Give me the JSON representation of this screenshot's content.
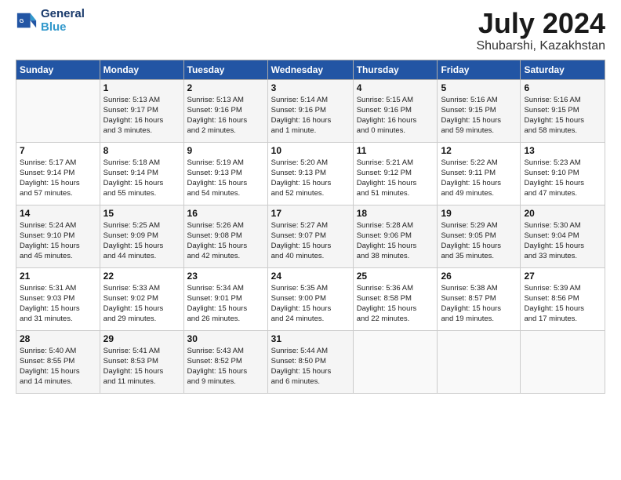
{
  "logo": {
    "line1": "General",
    "line2": "Blue"
  },
  "title": "July 2024",
  "location": "Shubarshi, Kazakhstan",
  "days_header": [
    "Sunday",
    "Monday",
    "Tuesday",
    "Wednesday",
    "Thursday",
    "Friday",
    "Saturday"
  ],
  "weeks": [
    [
      {
        "num": "",
        "info": ""
      },
      {
        "num": "1",
        "info": "Sunrise: 5:13 AM\nSunset: 9:17 PM\nDaylight: 16 hours\nand 3 minutes."
      },
      {
        "num": "2",
        "info": "Sunrise: 5:13 AM\nSunset: 9:16 PM\nDaylight: 16 hours\nand 2 minutes."
      },
      {
        "num": "3",
        "info": "Sunrise: 5:14 AM\nSunset: 9:16 PM\nDaylight: 16 hours\nand 1 minute."
      },
      {
        "num": "4",
        "info": "Sunrise: 5:15 AM\nSunset: 9:16 PM\nDaylight: 16 hours\nand 0 minutes."
      },
      {
        "num": "5",
        "info": "Sunrise: 5:16 AM\nSunset: 9:15 PM\nDaylight: 15 hours\nand 59 minutes."
      },
      {
        "num": "6",
        "info": "Sunrise: 5:16 AM\nSunset: 9:15 PM\nDaylight: 15 hours\nand 58 minutes."
      }
    ],
    [
      {
        "num": "7",
        "info": "Sunrise: 5:17 AM\nSunset: 9:14 PM\nDaylight: 15 hours\nand 57 minutes."
      },
      {
        "num": "8",
        "info": "Sunrise: 5:18 AM\nSunset: 9:14 PM\nDaylight: 15 hours\nand 55 minutes."
      },
      {
        "num": "9",
        "info": "Sunrise: 5:19 AM\nSunset: 9:13 PM\nDaylight: 15 hours\nand 54 minutes."
      },
      {
        "num": "10",
        "info": "Sunrise: 5:20 AM\nSunset: 9:13 PM\nDaylight: 15 hours\nand 52 minutes."
      },
      {
        "num": "11",
        "info": "Sunrise: 5:21 AM\nSunset: 9:12 PM\nDaylight: 15 hours\nand 51 minutes."
      },
      {
        "num": "12",
        "info": "Sunrise: 5:22 AM\nSunset: 9:11 PM\nDaylight: 15 hours\nand 49 minutes."
      },
      {
        "num": "13",
        "info": "Sunrise: 5:23 AM\nSunset: 9:10 PM\nDaylight: 15 hours\nand 47 minutes."
      }
    ],
    [
      {
        "num": "14",
        "info": "Sunrise: 5:24 AM\nSunset: 9:10 PM\nDaylight: 15 hours\nand 45 minutes."
      },
      {
        "num": "15",
        "info": "Sunrise: 5:25 AM\nSunset: 9:09 PM\nDaylight: 15 hours\nand 44 minutes."
      },
      {
        "num": "16",
        "info": "Sunrise: 5:26 AM\nSunset: 9:08 PM\nDaylight: 15 hours\nand 42 minutes."
      },
      {
        "num": "17",
        "info": "Sunrise: 5:27 AM\nSunset: 9:07 PM\nDaylight: 15 hours\nand 40 minutes."
      },
      {
        "num": "18",
        "info": "Sunrise: 5:28 AM\nSunset: 9:06 PM\nDaylight: 15 hours\nand 38 minutes."
      },
      {
        "num": "19",
        "info": "Sunrise: 5:29 AM\nSunset: 9:05 PM\nDaylight: 15 hours\nand 35 minutes."
      },
      {
        "num": "20",
        "info": "Sunrise: 5:30 AM\nSunset: 9:04 PM\nDaylight: 15 hours\nand 33 minutes."
      }
    ],
    [
      {
        "num": "21",
        "info": "Sunrise: 5:31 AM\nSunset: 9:03 PM\nDaylight: 15 hours\nand 31 minutes."
      },
      {
        "num": "22",
        "info": "Sunrise: 5:33 AM\nSunset: 9:02 PM\nDaylight: 15 hours\nand 29 minutes."
      },
      {
        "num": "23",
        "info": "Sunrise: 5:34 AM\nSunset: 9:01 PM\nDaylight: 15 hours\nand 26 minutes."
      },
      {
        "num": "24",
        "info": "Sunrise: 5:35 AM\nSunset: 9:00 PM\nDaylight: 15 hours\nand 24 minutes."
      },
      {
        "num": "25",
        "info": "Sunrise: 5:36 AM\nSunset: 8:58 PM\nDaylight: 15 hours\nand 22 minutes."
      },
      {
        "num": "26",
        "info": "Sunrise: 5:38 AM\nSunset: 8:57 PM\nDaylight: 15 hours\nand 19 minutes."
      },
      {
        "num": "27",
        "info": "Sunrise: 5:39 AM\nSunset: 8:56 PM\nDaylight: 15 hours\nand 17 minutes."
      }
    ],
    [
      {
        "num": "28",
        "info": "Sunrise: 5:40 AM\nSunset: 8:55 PM\nDaylight: 15 hours\nand 14 minutes."
      },
      {
        "num": "29",
        "info": "Sunrise: 5:41 AM\nSunset: 8:53 PM\nDaylight: 15 hours\nand 11 minutes."
      },
      {
        "num": "30",
        "info": "Sunrise: 5:43 AM\nSunset: 8:52 PM\nDaylight: 15 hours\nand 9 minutes."
      },
      {
        "num": "31",
        "info": "Sunrise: 5:44 AM\nSunset: 8:50 PM\nDaylight: 15 hours\nand 6 minutes."
      },
      {
        "num": "",
        "info": ""
      },
      {
        "num": "",
        "info": ""
      },
      {
        "num": "",
        "info": ""
      }
    ]
  ]
}
